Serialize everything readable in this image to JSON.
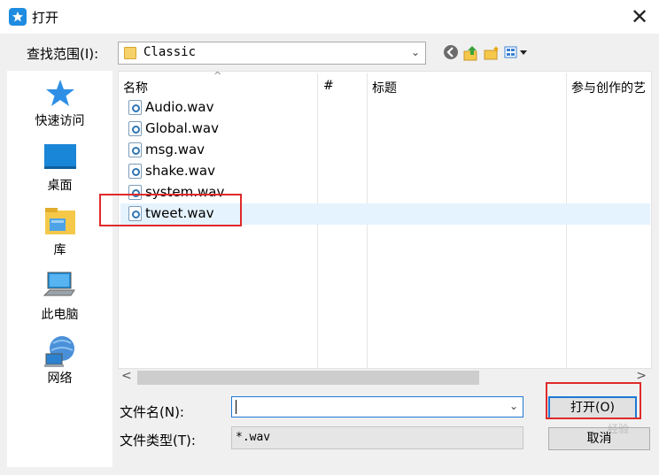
{
  "window": {
    "title": "打开",
    "close_glyph": "✕"
  },
  "lookin": {
    "label": "查找范围(I):",
    "value": "Classic"
  },
  "toolbar_icons": [
    "back-icon",
    "up-folder-icon",
    "new-folder-icon",
    "view-menu-icon"
  ],
  "places": [
    {
      "label": "快速访问",
      "icon": "star-icon"
    },
    {
      "label": "桌面",
      "icon": "desktop-icon"
    },
    {
      "label": "库",
      "icon": "library-icon"
    },
    {
      "label": "此电脑",
      "icon": "computer-icon"
    },
    {
      "label": "网络",
      "icon": "network-icon"
    }
  ],
  "columns": {
    "name": "名称",
    "number": "#",
    "title": "标题",
    "contributor": "参与创作的艺"
  },
  "files": [
    {
      "name": "Audio.wav"
    },
    {
      "name": "Global.wav"
    },
    {
      "name": "msg.wav"
    },
    {
      "name": "shake.wav"
    },
    {
      "name": "system.wav"
    },
    {
      "name": "tweet.wav",
      "selected": true
    }
  ],
  "filename": {
    "label": "文件名(N):",
    "value": ""
  },
  "filetype": {
    "label": "文件类型(T):",
    "value": "*.wav"
  },
  "buttons": {
    "open": "打开(O)",
    "cancel": "取消"
  },
  "watermark": "经验",
  "colors": {
    "highlight": "#e02a2a",
    "accent": "#1e7ad4",
    "selected_row": "#e5f3ff"
  }
}
